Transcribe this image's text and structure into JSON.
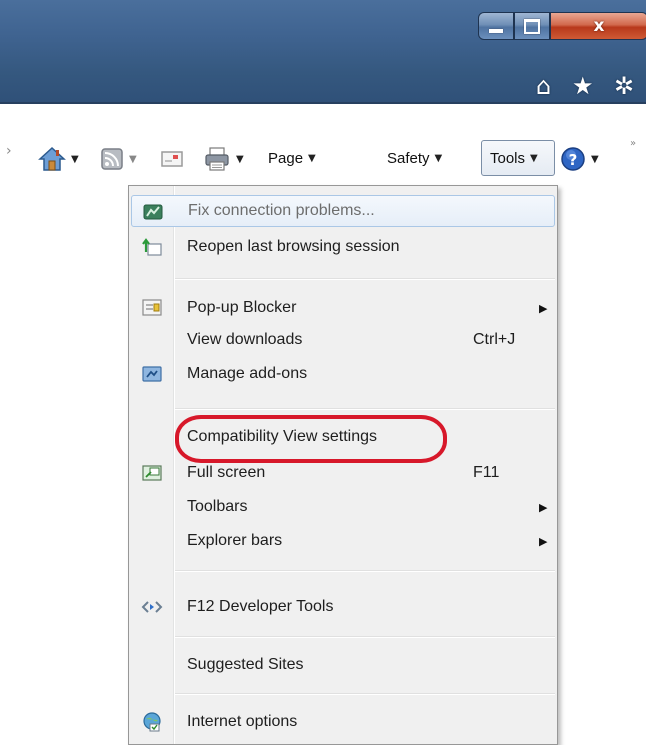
{
  "window": {
    "minimize_icon": "minimize-icon",
    "maximize_icon": "maximize-icon",
    "close_glyph": "x"
  },
  "nav": {
    "home_glyph": "⌂",
    "favorites_glyph": "★",
    "settings_glyph": "✲"
  },
  "command_bar": {
    "page_label": "Page",
    "safety_label": "Safety",
    "tools_label": "Tools",
    "overflow_left": "›",
    "overflow_right": "»",
    "caret": "▼"
  },
  "menu": {
    "items": [
      {
        "label": "Fix connection problems...",
        "icon": "network-diagnose-icon",
        "disabled": true
      },
      {
        "label": "Reopen last browsing session",
        "icon": "reopen-session-icon"
      },
      {
        "label": "Pop-up Blocker",
        "icon": "popup-blocker-icon",
        "submenu": "▶"
      },
      {
        "label": "View downloads",
        "shortcut": "Ctrl+J"
      },
      {
        "label": "Manage add-ons",
        "icon": "addons-icon"
      },
      {
        "label": "Compatibility View settings"
      },
      {
        "label": "Full screen",
        "icon": "fullscreen-icon",
        "shortcut": "F11"
      },
      {
        "label": "Toolbars",
        "submenu": "▶"
      },
      {
        "label": "Explorer bars",
        "submenu": "▶"
      },
      {
        "label": "F12 Developer Tools",
        "icon": "developer-tools-icon"
      },
      {
        "label": "Suggested Sites"
      },
      {
        "label": "Internet options",
        "icon": "internet-options-icon"
      }
    ]
  },
  "colors": {
    "titlebar": "#3f6390",
    "highlight_ellipse": "#d7182a",
    "menu_background": "#f0f0f0"
  }
}
